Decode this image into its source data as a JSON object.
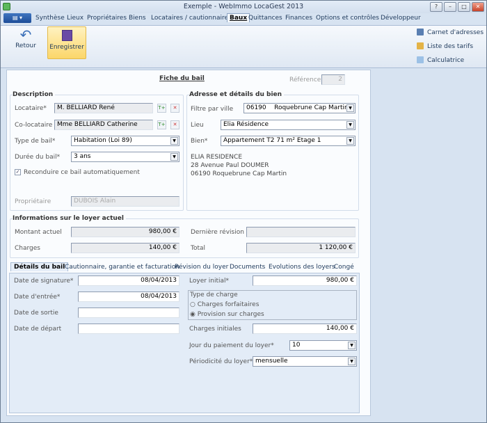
{
  "window": {
    "title": "Exemple - WebImmo LocaGest 2013",
    "help": "?",
    "minimize": "–",
    "maximize": "□",
    "close": "✕"
  },
  "ribbon_tabs": [
    "Synthèse",
    "Lieux",
    "Propriétaires",
    "Biens",
    "Locataires / cautionnaires",
    "Baux",
    "Quittances",
    "Finances",
    "Options et contrôles",
    "Développeur"
  ],
  "file_menu": "▤ ▾",
  "toolbar": {
    "back": "Retour",
    "save": "Enregistrer"
  },
  "side_links": [
    "Carnet d'adresses",
    "Liste des tarifs",
    "Calculatrice"
  ],
  "form": {
    "title": "Fiche du bail",
    "reference_label": "Référence",
    "reference": "2",
    "description": {
      "title": "Description",
      "locataire_label": "Locataire*",
      "locataire": "M. BELLIARD René",
      "colocataire_label": "Co-locataire",
      "colocataire": "Mme BELLIARD Catherine",
      "type_label": "Type de bail*",
      "type": "Habitation (Loi 89)",
      "duree_label": "Durée du bail*",
      "duree": "3 ans",
      "reconduire": "Reconduire ce bail automatiquement",
      "reconduire_checked": true,
      "proprietaire_label": "Propriétaire",
      "proprietaire": "DUBOIS Alain"
    },
    "adresse": {
      "title": "Adresse et détails du bien",
      "filtre_label": "Filtre par ville",
      "filtre_cp": "06190",
      "filtre_ville": "Roquebrune Cap Martin",
      "lieu_label": "Lieu",
      "lieu": "Elia Résidence",
      "bien_label": "Bien*",
      "bien": "Appartement T2 71 m² Etage 1",
      "address_lines": [
        "ELIA RESIDENCE",
        "28 Avenue Paul DOUMER",
        "06190 Roquebrune Cap Martin"
      ]
    },
    "loyer": {
      "title": "Informations sur le loyer actuel",
      "montant_label": "Montant actuel",
      "montant": "980,00 €",
      "derniere_revision_label": "Dernière révision",
      "derniere_revision": "",
      "charges_label": "Charges",
      "charges": "140,00 €",
      "total_label": "Total",
      "total": "1 120,00 €"
    },
    "tabs": [
      "Détails du bail",
      "Cautionnaire, garantie et facturation",
      "Révision du loyer",
      "Documents",
      "Evolutions des loyers",
      "Congé"
    ],
    "details": {
      "signature_label": "Date de signature*",
      "signature": "08/04/2013",
      "entree_label": "Date d'entrée*",
      "entree": "08/04/2013",
      "sortie_label": "Date de sortie",
      "sortie": "",
      "depart_label": "Date de départ",
      "depart": "",
      "loyer_initial_label": "Loyer initial*",
      "loyer_initial": "980,00 €",
      "type_charge_label": "Type de charge",
      "charges_forfaitaires": "Charges forfaitaires",
      "provision": "Provision sur charges",
      "charges_initiales_label": "Charges initiales",
      "charges_initiales": "140,00 €",
      "jour_label": "Jour du paiement du loyer*",
      "jour": "10",
      "periodicite_label": "Périodicité du loyer*",
      "periodicite": "mensuelle"
    }
  }
}
